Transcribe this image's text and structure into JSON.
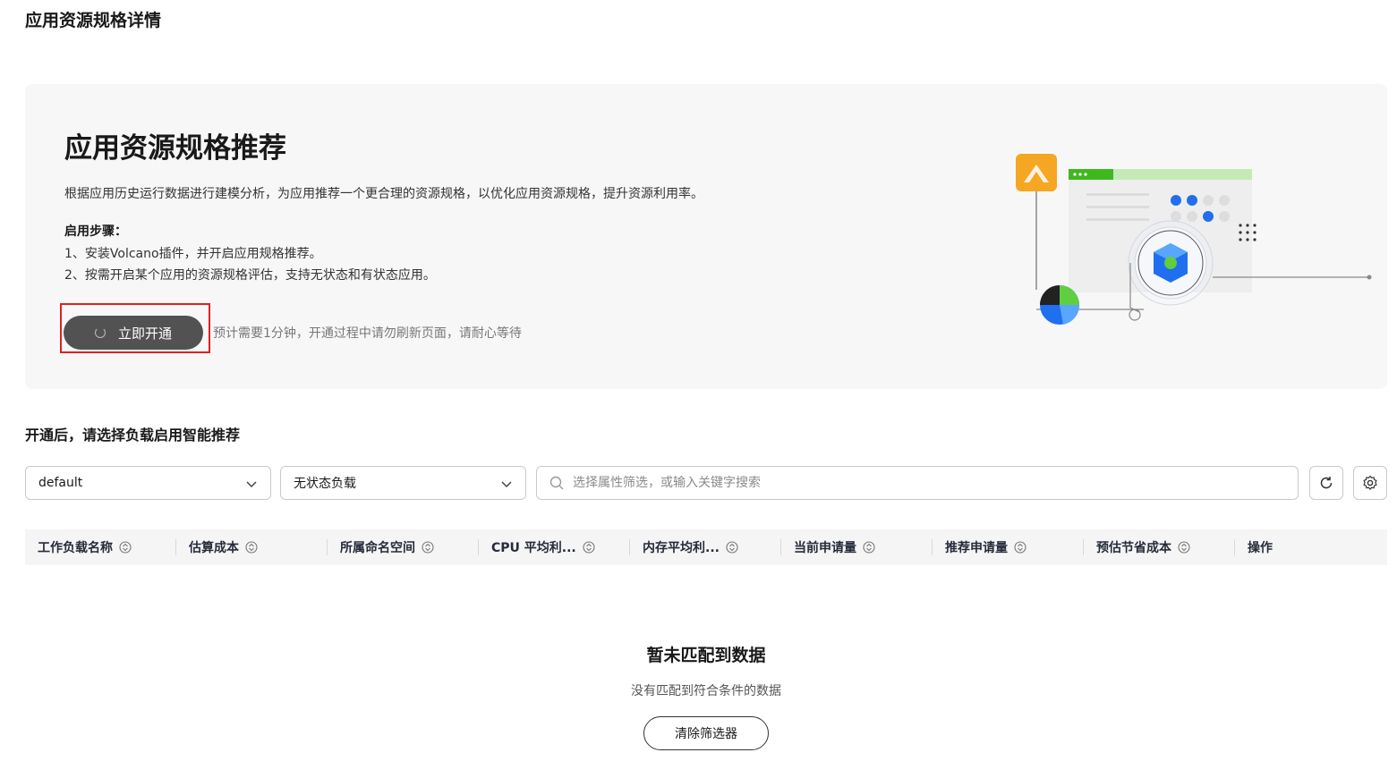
{
  "page_title": "应用资源规格详情",
  "hero": {
    "title": "应用资源规格推荐",
    "description": "根据应用历史运行数据进行建模分析，为应用推荐一个更合理的资源规格，以优化应用资源规格，提升资源利用率。",
    "steps_title": "启用步骤：",
    "steps": [
      "1、安装Volcano插件，并开启应用规格推荐。",
      "2、按需开启某个应用的资源规格评估，支持无状态和有状态应用。"
    ],
    "enable_button": "立即开通",
    "enable_hint": "预计需要1分钟，开通过程中请勿刷新页面，请耐心等待"
  },
  "section_title": "开通后，请选择负载启用智能推荐",
  "filters": {
    "namespace": "default",
    "workload_type": "无状态负载",
    "search_placeholder": "选择属性筛选，或输入关键字搜索"
  },
  "table": {
    "columns": [
      "工作负载名称",
      "估算成本",
      "所属命名空间",
      "CPU 平均利...",
      "内存平均利...",
      "当前申请量",
      "推荐申请量",
      "预估节省成本",
      "操作"
    ],
    "rows": []
  },
  "empty": {
    "title": "暂未匹配到数据",
    "description": "没有匹配到符合条件的数据",
    "clear_button": "清除筛选器"
  },
  "colors": {
    "primary_button": "#525252",
    "highlight_border": "#e02020",
    "hero_bg": "#f7f7f7",
    "accent_blue": "#1f6ff0",
    "accent_orange": "#f5a623",
    "accent_green": "#5fcf3f"
  }
}
